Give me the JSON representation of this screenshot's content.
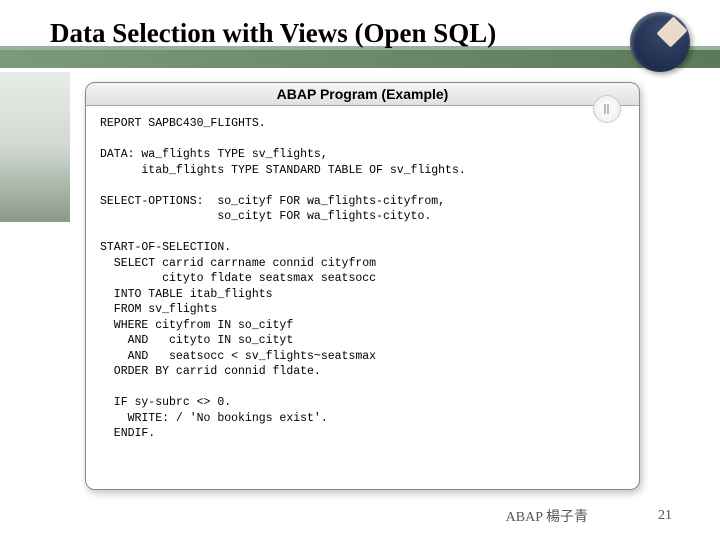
{
  "slide": {
    "title": "Data Selection with Views (Open SQL)",
    "panelTitle": "ABAP Program (Example)",
    "footerText": "ABAP 楊子青",
    "pageNumber": "21"
  },
  "code": {
    "line01": "REPORT SAPBC430_FLIGHTS.",
    "blank1": "",
    "line02": "DATA: wa_flights TYPE sv_flights,",
    "line03": "      itab_flights TYPE STANDARD TABLE OF sv_flights.",
    "blank2": "",
    "line04": "SELECT-OPTIONS:  so_cityf FOR wa_flights-cityfrom,",
    "line05": "                 so_cityt FOR wa_flights-cityto.",
    "blank3": "",
    "line06": "START-OF-SELECTION.",
    "line07": "  SELECT carrid carrname connid cityfrom",
    "line08": "         cityto fldate seatsmax seatsocc",
    "line09": "  INTO TABLE itab_flights",
    "line10": "  FROM sv_flights",
    "line11": "  WHERE cityfrom IN so_cityf",
    "line12": "    AND   cityto IN so_cityt",
    "line13": "    AND   seatsocc < sv_flights~seatsmax",
    "line14": "  ORDER BY carrid connid fldate.",
    "blank4": "",
    "line15": "  IF sy-subrc <> 0.",
    "line16": "    WRITE: / 'No bookings exist'.",
    "line17": "  ENDIF."
  }
}
